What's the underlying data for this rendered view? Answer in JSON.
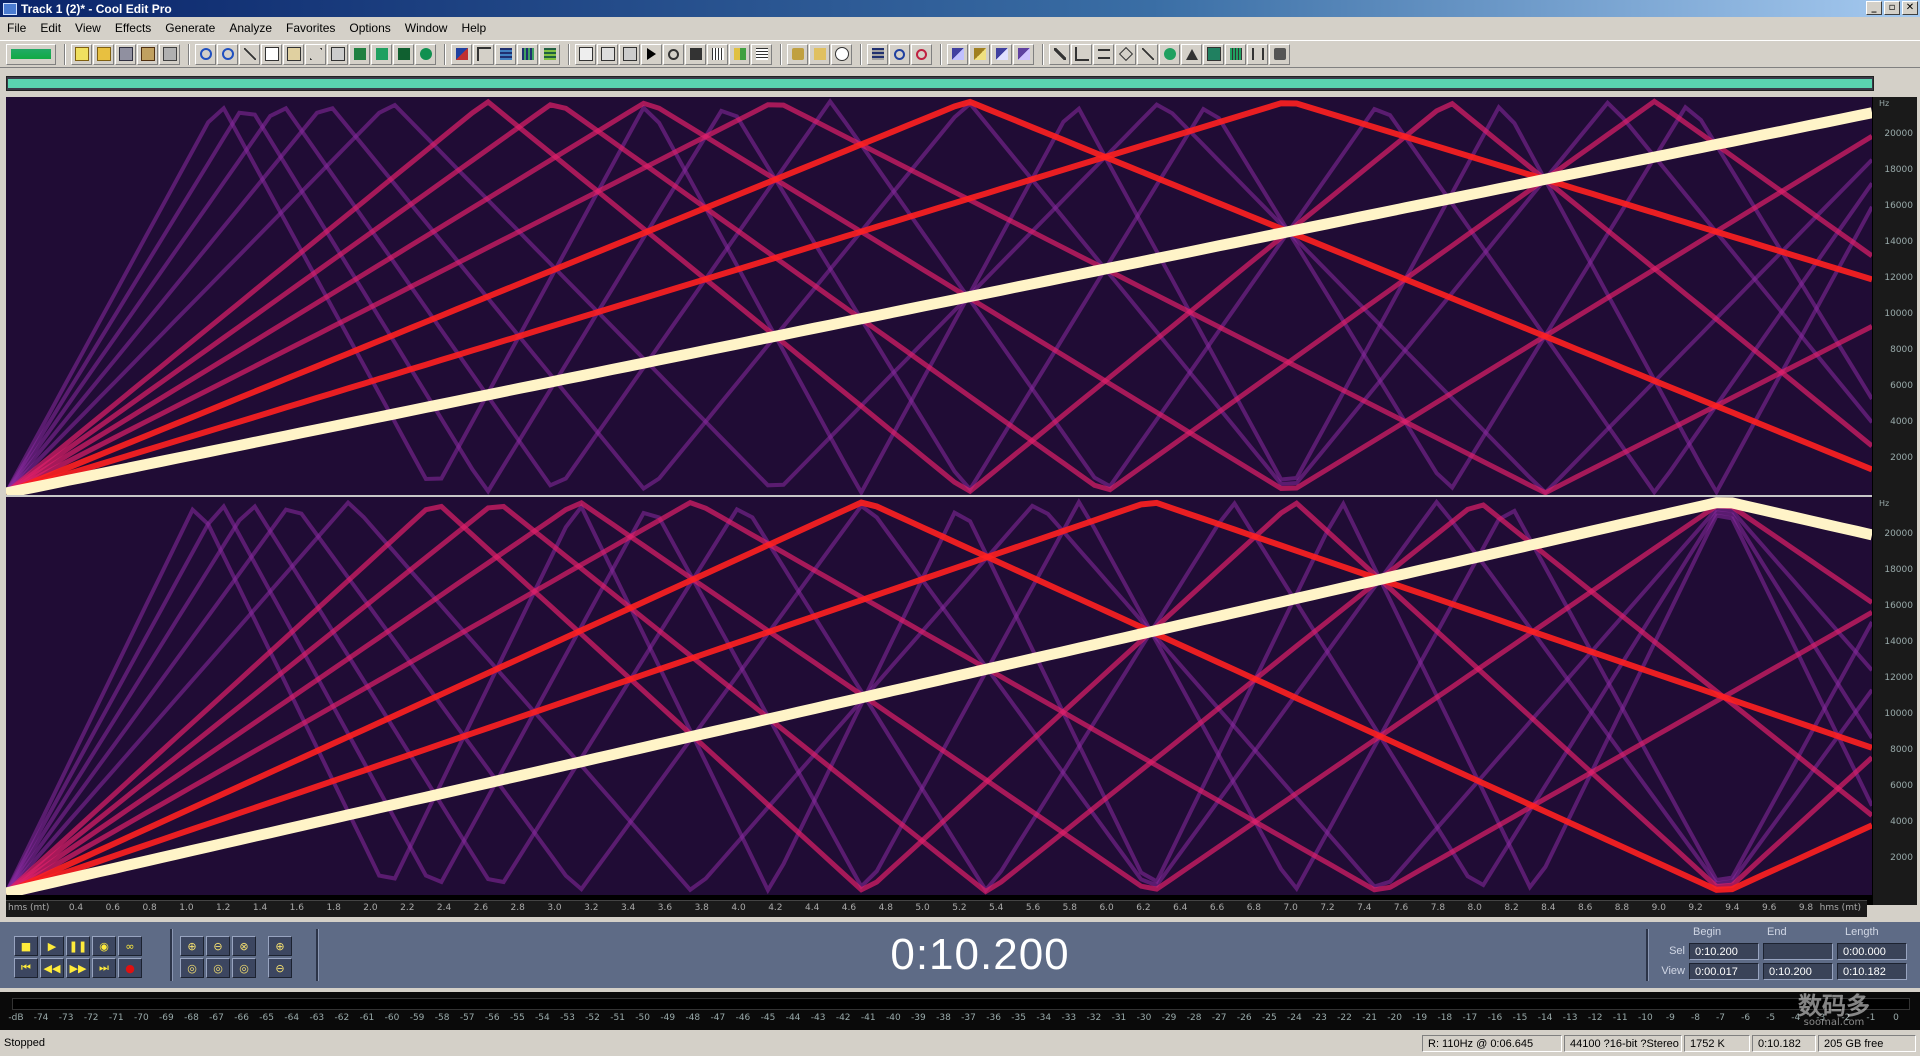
{
  "window": {
    "title": "Track 1 (2)* - Cool Edit Pro",
    "controls": [
      "_",
      "▫",
      "✕"
    ]
  },
  "menu": [
    "File",
    "Edit",
    "View",
    "Effects",
    "Generate",
    "Analyze",
    "Favorites",
    "Options",
    "Window",
    "Help"
  ],
  "spectral": {
    "hz_unit": "Hz",
    "hz_ticks": [
      "20000",
      "18000",
      "16000",
      "14000",
      "12000",
      "10000",
      "8000",
      "6000",
      "4000",
      "2000"
    ],
    "time_unit": "hms (mt)",
    "time_ticks": [
      "0.4",
      "0.6",
      "0.8",
      "1.0",
      "1.2",
      "1.4",
      "1.6",
      "1.8",
      "2.0",
      "2.2",
      "2.4",
      "2.6",
      "2.8",
      "3.0",
      "3.2",
      "3.4",
      "3.6",
      "3.8",
      "4.0",
      "4.2",
      "4.4",
      "4.6",
      "4.8",
      "5.0",
      "5.2",
      "5.4",
      "5.6",
      "5.8",
      "6.0",
      "6.2",
      "6.4",
      "6.6",
      "6.8",
      "7.0",
      "7.2",
      "7.4",
      "7.6",
      "7.8",
      "8.0",
      "8.2",
      "8.4",
      "8.6",
      "8.8",
      "9.0",
      "9.2",
      "9.4",
      "9.6",
      "9.8"
    ],
    "colors": {
      "background": "#1a0a2e",
      "fundamental": "#fff4c8",
      "harmonic_hot": "#ff2020",
      "harmonic_mid": "#e0206a",
      "harmonic_dim": "#8a2aa0"
    }
  },
  "transport": {
    "current_time": "0:10.200"
  },
  "selection": {
    "headers": {
      "begin": "Begin",
      "end": "End",
      "length": "Length"
    },
    "sel_label": "Sel",
    "view_label": "View",
    "sel": {
      "begin": "0:10.200",
      "end": "",
      "length": "0:00.000"
    },
    "view": {
      "begin": "0:00.017",
      "end": "0:10.200",
      "length": "0:10.182"
    }
  },
  "meter": {
    "ticks": [
      "-dB",
      "-74",
      "-73",
      "-72",
      "-71",
      "-70",
      "-69",
      "-68",
      "-67",
      "-66",
      "-65",
      "-64",
      "-63",
      "-62",
      "-61",
      "-60",
      "-59",
      "-58",
      "-57",
      "-56",
      "-55",
      "-54",
      "-53",
      "-52",
      "-51",
      "-50",
      "-49",
      "-48",
      "-47",
      "-46",
      "-45",
      "-44",
      "-43",
      "-42",
      "-41",
      "-40",
      "-39",
      "-38",
      "-37",
      "-36",
      "-35",
      "-34",
      "-33",
      "-32",
      "-31",
      "-30",
      "-29",
      "-28",
      "-27",
      "-26",
      "-25",
      "-24",
      "-23",
      "-22",
      "-21",
      "-20",
      "-19",
      "-18",
      "-17",
      "-16",
      "-15",
      "-14",
      "-13",
      "-12",
      "-11",
      "-10",
      "-9",
      "-8",
      "-7",
      "-6",
      "-5",
      "-4",
      "-3",
      "-2",
      "-1",
      "0"
    ]
  },
  "status": {
    "state": "Stopped",
    "cursor": "R: 110Hz @  0:06.645",
    "format": "44100 ?16-bit ?Stereo",
    "size": "1752 K",
    "duration": "0:10.182",
    "free": "205 GB free"
  },
  "watermark": {
    "text": "数码多",
    "sub": "soomal.com"
  }
}
